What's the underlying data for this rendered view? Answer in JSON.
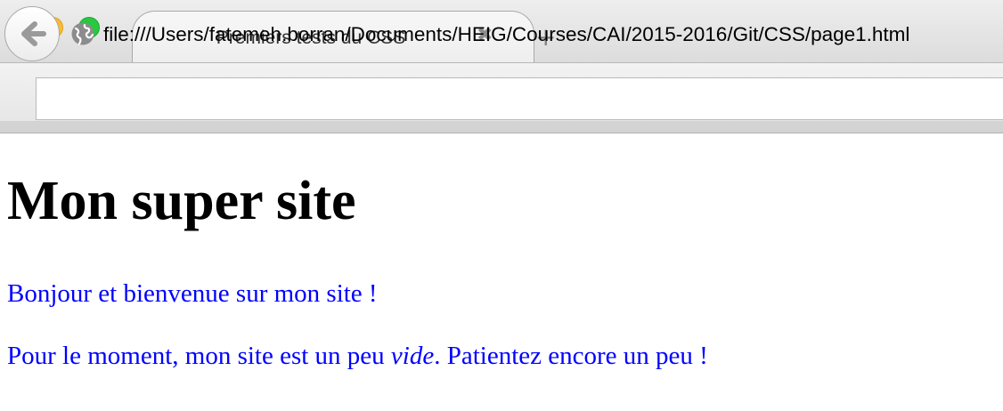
{
  "browser": {
    "tab": {
      "title": "Premiers tests du CSS",
      "close_glyph": "✖",
      "new_tab_glyph": "+"
    },
    "url": "file:///Users/fatemeh.borran/Documents/HEIG/Courses/CAI/2015-2016/Git/CSS/page1.html",
    "icons": {
      "back": "back-arrow-icon",
      "site": "globe-icon"
    },
    "traffic_lights": {
      "close": "#fc5f57",
      "minimize": "#fdbc2e",
      "zoom": "#28c840"
    }
  },
  "page": {
    "heading": "Mon super site",
    "paragraph1": "Bonjour et bienvenue sur mon site !",
    "paragraph2": {
      "before": "Pour le moment, mon site est un peu ",
      "emphasis": "vide",
      "after": ". Patientez encore un peu !"
    },
    "colors": {
      "heading": "#000000",
      "paragraph": "#0000ff"
    }
  }
}
